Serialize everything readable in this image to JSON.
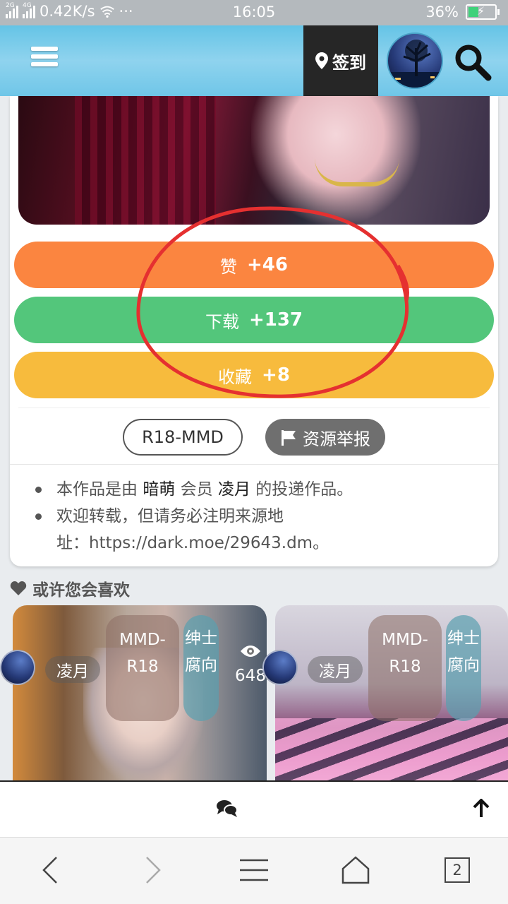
{
  "status_bar": {
    "network_1": "2G",
    "network_2": "4G",
    "speed": "0.42K/s",
    "more": "···",
    "time": "16:05",
    "battery": "36%",
    "battery_level": 0.36
  },
  "header": {
    "checkin_label": "签到",
    "icons": [
      "menu-icon",
      "location-pin-icon",
      "avatar",
      "search-icon"
    ],
    "accent": "#6ec6e8"
  },
  "actions": {
    "like": {
      "label": "赞",
      "count": "+46",
      "color": "#fb8540"
    },
    "download": {
      "label": "下载",
      "count": "+137",
      "color": "#53c67b"
    },
    "favorite": {
      "label": "收藏",
      "count": "+8",
      "color": "#f7bb3d"
    }
  },
  "tags": {
    "category": "R18-MMD",
    "report_label": "资源举报"
  },
  "info": {
    "line1_prefix": "本作品是由",
    "line1_site": "暗萌",
    "line1_mid": "会员",
    "line1_user": "凌月",
    "line1_suffix": "的投递作品。",
    "line2_a": "欢迎转载，但请务必注明来源地",
    "line2_b": "址：https://dark.moe/29643.dm。"
  },
  "related": {
    "title": "或许您会喜欢",
    "items": [
      {
        "user": "凌月",
        "category": "MMD-R18",
        "tag": "绅士腐向",
        "views": "648"
      },
      {
        "user": "凌月",
        "category": "MMD-R18",
        "tag": "绅士腐向"
      }
    ]
  },
  "browser_nav": {
    "tab_count": "2"
  }
}
